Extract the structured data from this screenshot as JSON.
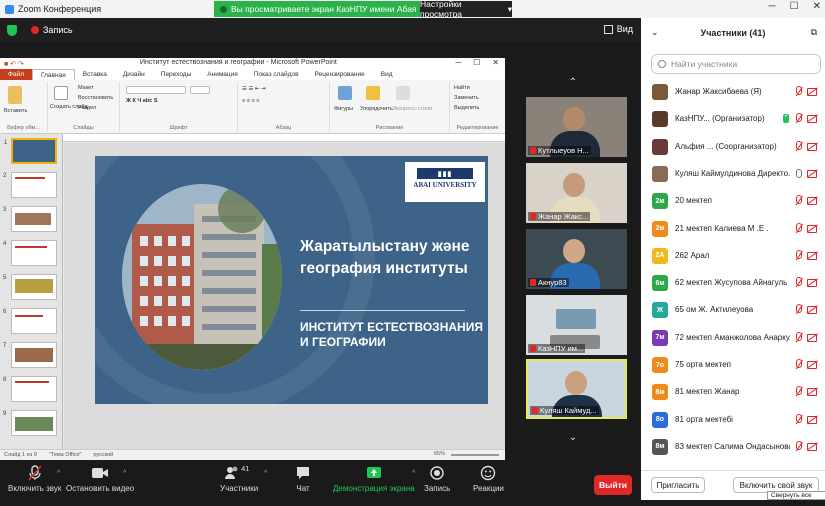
{
  "window": {
    "title": "Zoom Конференция"
  },
  "banner": {
    "sharing_text": "Вы просматриваете экран КазНПУ имени Абая",
    "view_options": "Настройки просмотра"
  },
  "meeting_bar": {
    "record_label": "Запись",
    "view_label": "Вид"
  },
  "ppt": {
    "title": "Институт естествознания и географии - Microsoft PowerPoint",
    "tabs": [
      "Файл",
      "Главная",
      "Вставка",
      "Дизайн",
      "Переходы",
      "Анимация",
      "Показ слайдов",
      "Рецензирование",
      "Вид"
    ],
    "ribbon": {
      "paste": "Вставить",
      "clipboard": "Буфер обм...",
      "new_slide": "Создать слайд",
      "layout": "Макет",
      "reset": "Восстановить",
      "section": "Раздел",
      "slides_group": "Слайды",
      "font_group": "Шрифт",
      "paragraph_group": "Абзац",
      "figures": "Фигуры",
      "arrange": "Упорядочить",
      "quick_styles": "Экспресс-стили",
      "drawing_group": "Рисование",
      "find": "Найти",
      "replace": "Заменить",
      "select": "Выделить",
      "editing_group": "Редактирование"
    },
    "thumbnail_numbers": [
      "1",
      "2",
      "3",
      "4",
      "5",
      "6",
      "7",
      "8",
      "9"
    ],
    "slide": {
      "logo_text": "ABAI UNIVERSITY",
      "title_kz": "Жаратылыстану және география институты",
      "title_ru": "ИНСТИТУТ ЕСТЕСТВОЗНАНИЯ И ГЕОГРАФИИ"
    },
    "status": {
      "slide": "Слайд 1 из 9",
      "theme": "\"Тема Office\"",
      "lang": "русский",
      "zoom": "65%"
    }
  },
  "videos": [
    {
      "name": "Кутлыеуов Н..."
    },
    {
      "name": "Жанар Жакс..."
    },
    {
      "name": "Акнур83"
    },
    {
      "name": "КазНПУ им..."
    },
    {
      "name": "Куляш Каймуд..."
    }
  ],
  "panel": {
    "header": "Участники (41)",
    "search_placeholder": "Найти участника",
    "participants": [
      {
        "initials": "",
        "name": "Жанар Жаксибаева (Я)",
        "color": "#7a5a3a",
        "rename_chip": ""
      },
      {
        "initials": "",
        "name": "КазНПУ... (Организатор)",
        "color": "#5a3a2a",
        "rename_chip": "•"
      },
      {
        "initials": "",
        "name": "Альфия ... (Соорганизатор)",
        "color": "#6a3a3a",
        "rename_chip": ""
      },
      {
        "initials": "",
        "name": "Куляш Каймулдинова Директо...",
        "color": "#8a6a5a",
        "rename_chip": ""
      },
      {
        "initials": "2м",
        "name": "20 мектеп",
        "color": "#2aa84a",
        "rename_chip": ""
      },
      {
        "initials": "2м",
        "name": "21  мектеп Калиева М .Е .",
        "color": "#f08a1a",
        "rename_chip": ""
      },
      {
        "initials": "2А",
        "name": "262 Арал",
        "color": "#f0b81a",
        "rename_chip": ""
      },
      {
        "initials": "6м",
        "name": "62 мектеп Жусупова Айнагуль",
        "color": "#2aa84a",
        "rename_chip": ""
      },
      {
        "initials": "Ж",
        "name": "65 ом  Ж. Актилеуова",
        "color": "#26a89a",
        "rename_chip": ""
      },
      {
        "initials": "7м",
        "name": "72 мектеп Аманжолова Анарку...",
        "color": "#7a3ab8",
        "rename_chip": ""
      },
      {
        "initials": "7о",
        "name": "75 орта мектеп",
        "color": "#f08a1a",
        "rename_chip": ""
      },
      {
        "initials": "8м",
        "name": "81 мектеп Жанар",
        "color": "#f08a1a",
        "rename_chip": ""
      },
      {
        "initials": "8о",
        "name": "81 орта мектебі",
        "color": "#2d6cdf",
        "rename_chip": ""
      },
      {
        "initials": "8м",
        "name": "83 мектеп Салима Ондасынова",
        "color": "#555555",
        "rename_chip": ""
      }
    ],
    "invite": "Пригласить",
    "unmute": "Включить свой звук",
    "collapse_tip": "Свернуть все окна"
  },
  "toolbar": {
    "audio": "Включить звук",
    "video": "Остановить видео",
    "participants": "Участники",
    "participants_count": "41",
    "chat": "Чат",
    "share": "Демонстрация экрана",
    "record": "Запись",
    "reactions": "Реакции",
    "leave": "Выйти"
  }
}
